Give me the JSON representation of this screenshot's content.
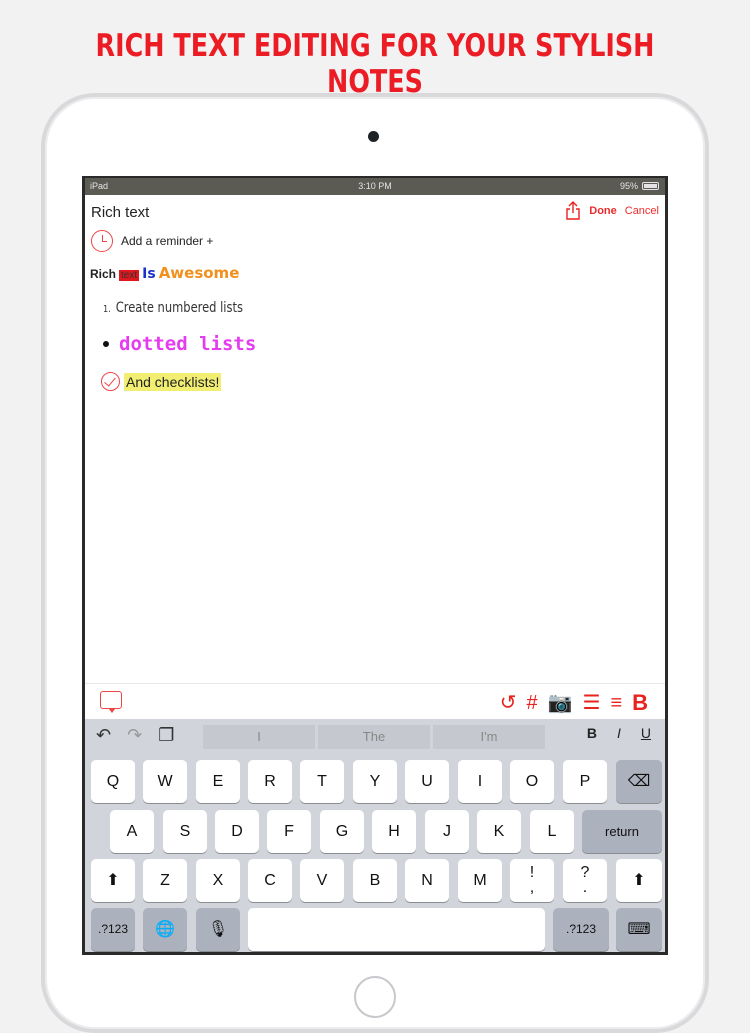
{
  "headline": "RICH TEXT EDITING FOR YOUR STYLISH NOTES",
  "status": {
    "carrier": "iPad",
    "time": "3:10 PM",
    "battery": "95%"
  },
  "nav": {
    "title": "Rich text",
    "done": "Done",
    "cancel": "Cancel",
    "share_icon": "share-icon"
  },
  "reminder": {
    "label": "Add a reminder +",
    "icon": "alarm-clock-icon"
  },
  "content": {
    "line1": {
      "rich": "Rich",
      "text": "text",
      "is": "Is",
      "awesome": "Awesome"
    },
    "numbered": {
      "number": "1.",
      "text": "Create numbered lists"
    },
    "dotted": "dotted lists",
    "checklist": "And checklists!"
  },
  "toolbar": {
    "undo": "↺",
    "hash": "#",
    "camera": "📷",
    "list": "☰",
    "align": "≡",
    "bold": "B",
    "colors": {
      "accent": "#e8221e"
    }
  },
  "keyboard": {
    "suggestions": [
      "I",
      "The",
      "I'm"
    ],
    "format": {
      "bold": "B",
      "italic": "I",
      "underline": "U"
    },
    "row1": [
      "Q",
      "W",
      "E",
      "R",
      "T",
      "Y",
      "U",
      "I",
      "O",
      "P"
    ],
    "row2": [
      "A",
      "S",
      "D",
      "F",
      "G",
      "H",
      "J",
      "K",
      "L"
    ],
    "row3": [
      "Z",
      "X",
      "C",
      "V",
      "B",
      "N",
      "M",
      "!\n,",
      "?\n."
    ],
    "return": "return",
    "numbers": ".?123",
    "backspace": "⌫",
    "shift": "⬆"
  }
}
